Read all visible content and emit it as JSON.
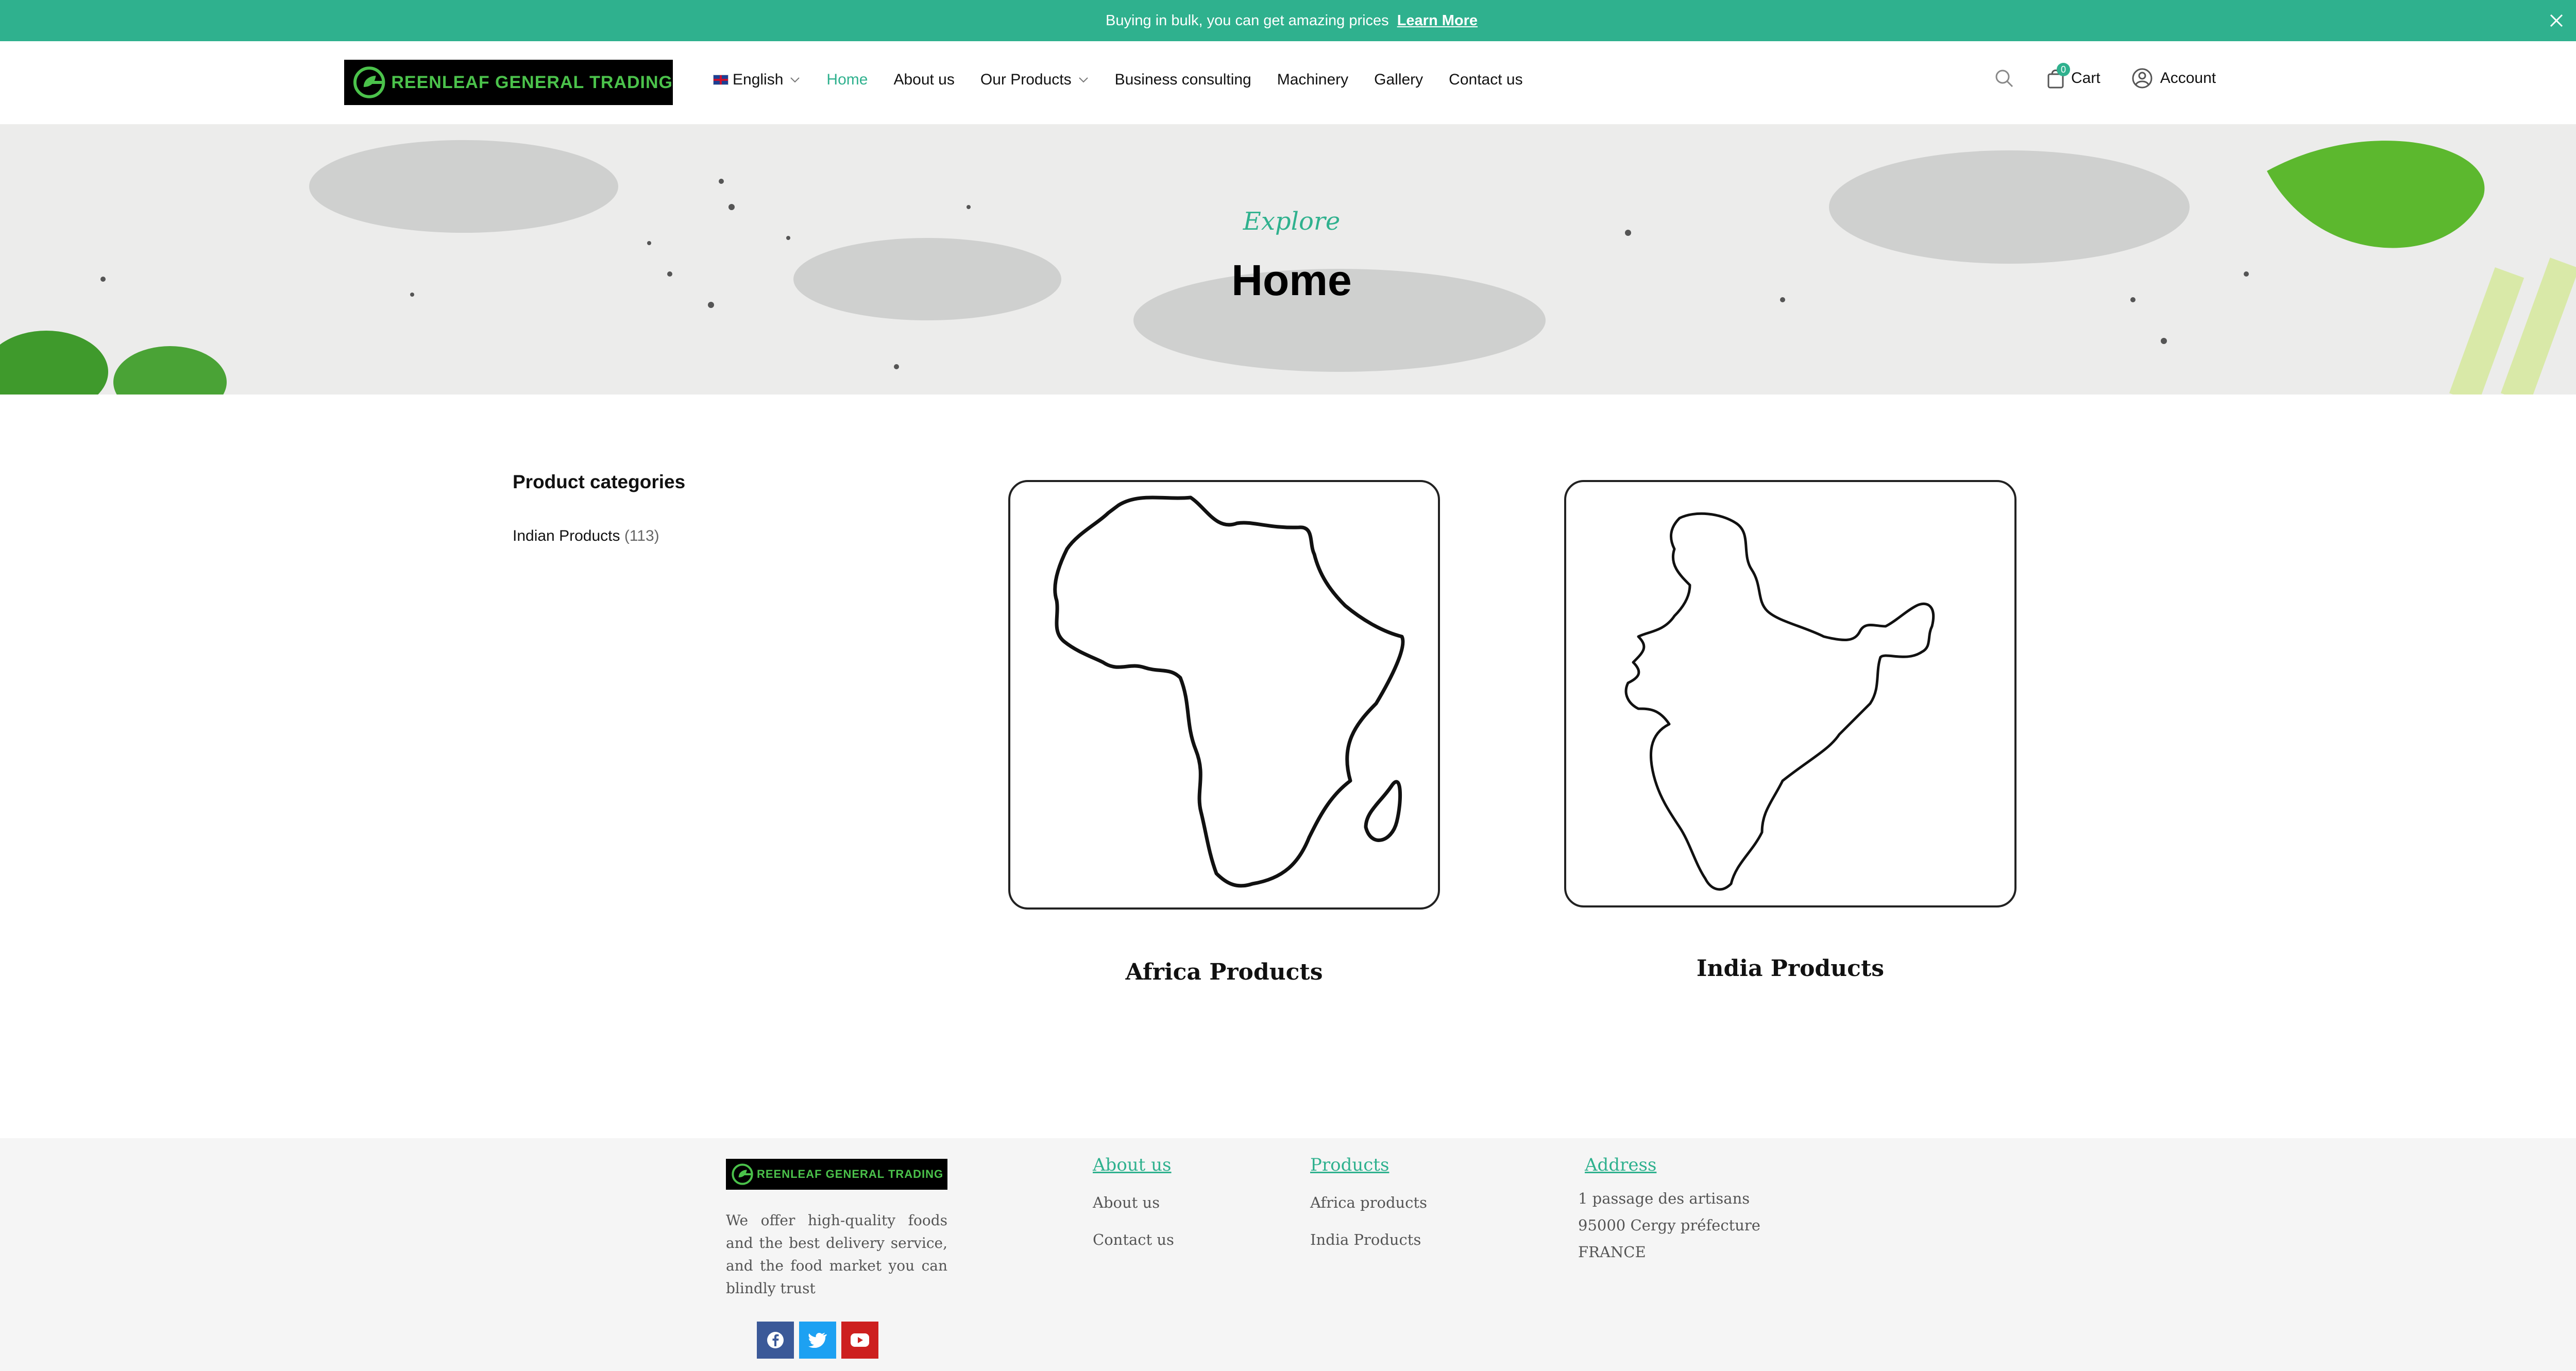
{
  "announcement": {
    "message": "Buying in bulk, you can get amazing prices",
    "link_label": "Learn More"
  },
  "brand": {
    "name": "REENLEAF GENERAL TRADING",
    "accent_color": "#2fb18e",
    "logo_green": "#4bc24b"
  },
  "nav": {
    "language": "English",
    "items": [
      {
        "label": "Home",
        "active": true
      },
      {
        "label": "About us"
      },
      {
        "label": "Our Products",
        "has_dropdown": true
      },
      {
        "label": "Business consulting"
      },
      {
        "label": "Machinery"
      },
      {
        "label": "Gallery"
      },
      {
        "label": "Contact us"
      }
    ],
    "cart_label": "Cart",
    "cart_count": "0",
    "account_label": "Account"
  },
  "hero": {
    "kicker": "Explore",
    "title": "Home"
  },
  "sidebar": {
    "title": "Product categories",
    "categories": [
      {
        "label": "Indian Products",
        "count": "(113)"
      }
    ]
  },
  "products": [
    {
      "label": "Africa Products",
      "icon": "africa-map-outline"
    },
    {
      "label": "India Products",
      "icon": "india-map-outline"
    }
  ],
  "footer": {
    "description": "We offer high-quality foods and the best delivery service, and the food market you can blindly trust",
    "about": {
      "title": "About us",
      "links": [
        "About us",
        "Contact us"
      ]
    },
    "products": {
      "title": "Products",
      "links": [
        "Africa products",
        "India Products"
      ]
    },
    "address": {
      "title": "Address",
      "lines": [
        "1 passage des artisans",
        "95000 Cergy préfecture",
        "FRANCE"
      ]
    },
    "socials": [
      {
        "name": "facebook-icon",
        "color": "#3b5998"
      },
      {
        "name": "twitter-icon",
        "color": "#1da1f2"
      },
      {
        "name": "youtube-icon",
        "color": "#cd201f"
      }
    ]
  }
}
